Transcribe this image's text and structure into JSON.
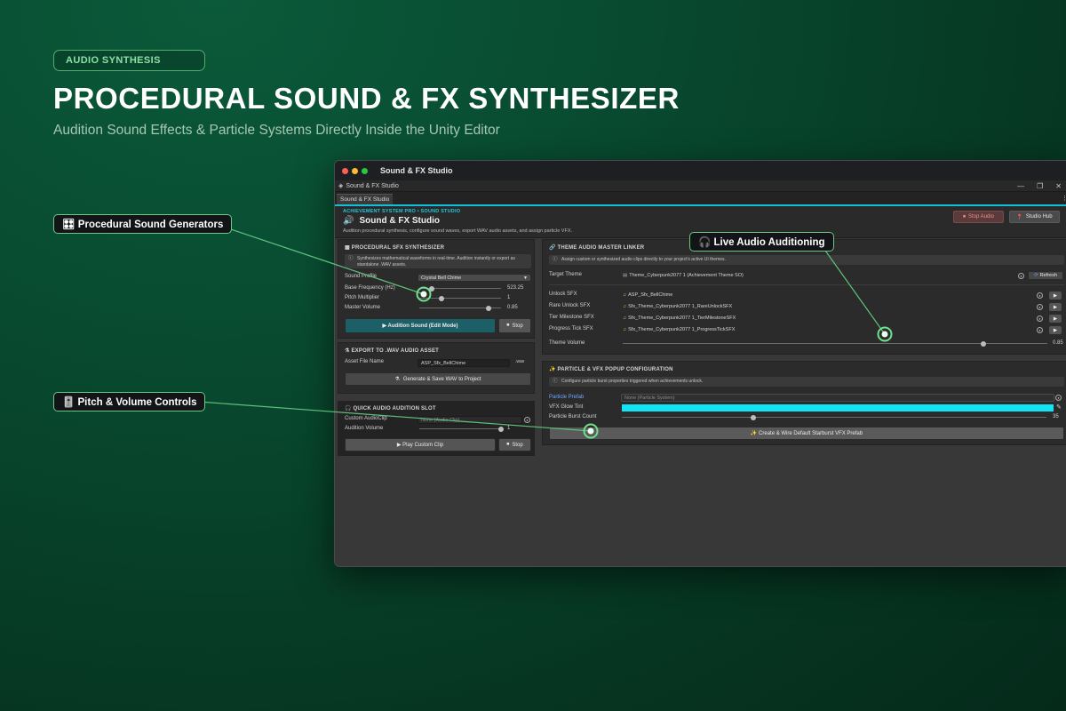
{
  "promo": {
    "badge": "AUDIO SYNTHESIS",
    "title": "PROCEDURAL SOUND & FX SYNTHESIZER",
    "subtitle": "Audition Sound Effects & Particle Systems Directly Inside the Unity Editor"
  },
  "callouts": {
    "generators": "🎛 Procedural Sound Generators",
    "pitch_volume": "🎚️ Pitch & Volume Controls",
    "live_audio": "🎧 Live Audio Auditioning"
  },
  "window": {
    "mac_title": "Sound & FX Studio",
    "unity_title": "Sound & FX Studio",
    "tab": "Sound & FX Studio",
    "breadcrumb": "ACHIEVEMENT SYSTEM PRO  •  SOUND STUDIO",
    "title": "Sound & FX Studio",
    "description": "Audition procedural synthesis, configure sound waves, export WAV audio assets, and assign particle VFX.",
    "stop_audio": "Stop Audio",
    "studio_hub": "Studio Hub"
  },
  "synth": {
    "title": "PROCEDURAL SFX SYNTHESIZER",
    "info": "Synthesizes mathematical waveforms in real-time. Audition instantly or export as standalone .WAV assets.",
    "profile_label": "Sound Profile",
    "profile_value": "Crystal Bell Chime",
    "freq_label": "Base Frequency (Hz)",
    "freq_value": "523.25",
    "freq_pos": 0.15,
    "pitch_label": "Pitch Multiplier",
    "pitch_value": "1",
    "pitch_pos": 0.27,
    "volume_label": "Master Volume",
    "volume_value": "0.85",
    "volume_pos": 0.85,
    "audition_btn": "▶ Audition Sound (Edit Mode)",
    "stop_btn": "Stop"
  },
  "export": {
    "title": "EXPORT TO .WAV AUDIO ASSET",
    "file_label": "Asset File Name",
    "file_value": "ASP_Sfx_BellChime",
    "file_ext": ".wav",
    "generate_btn": "Generate & Save WAV to Project"
  },
  "quick": {
    "title": "QUICK AUDIO AUDITION SLOT",
    "clip_label": "Custom AudioClip",
    "clip_value": "None (Audio Clip)",
    "vol_label": "Audition Volume",
    "vol_value": "1",
    "vol_pos": 1.0,
    "play_btn": "▶ Play Custom Clip",
    "stop_btn": "Stop"
  },
  "linker": {
    "title": "THEME AUDIO MASTER LINKER",
    "info": "Assign custom or synthesized audio clips directly to your project's active UI themes.",
    "target_label": "Target Theme",
    "target_value": "Theme_Cyberpunk2077 1 (Achievement Theme SO)",
    "refresh": "Refresh",
    "rows": [
      {
        "label": "Unlock SFX",
        "value": "ASP_Sfx_BellChime"
      },
      {
        "label": "Rare Unlock SFX",
        "value": "Sfx_Theme_Cyberpunk2077 1_RareUnlockSFX"
      },
      {
        "label": "Tier Milestone SFX",
        "value": "Sfx_Theme_Cyberpunk2077 1_TierMilestoneSFX"
      },
      {
        "label": "Progress Tick SFX",
        "value": "Sfx_Theme_Cyberpunk2077 1_ProgressTickSFX"
      }
    ],
    "volume_label": "Theme Volume",
    "volume_value": "0.85",
    "volume_pos": 0.85
  },
  "vfx": {
    "title": "PARTICLE & VFX POPUP CONFIGURATION",
    "info": "Configure particle burst properties triggered when achievements unlock.",
    "prefab_label": "Particle Prefab",
    "prefab_value": "None (Particle System)",
    "tint_label": "VFX Glow Tint",
    "tint_color": "#11e4f4",
    "burst_label": "Particle Burst Count",
    "burst_value": "35",
    "burst_pos": 0.31,
    "create_btn": "✨ Create & Wire Default Starburst VFX Prefab"
  },
  "colors": {
    "accent": "#11bfd8",
    "callout_border": "#6cc885",
    "badge_text": "#8be0a4"
  }
}
